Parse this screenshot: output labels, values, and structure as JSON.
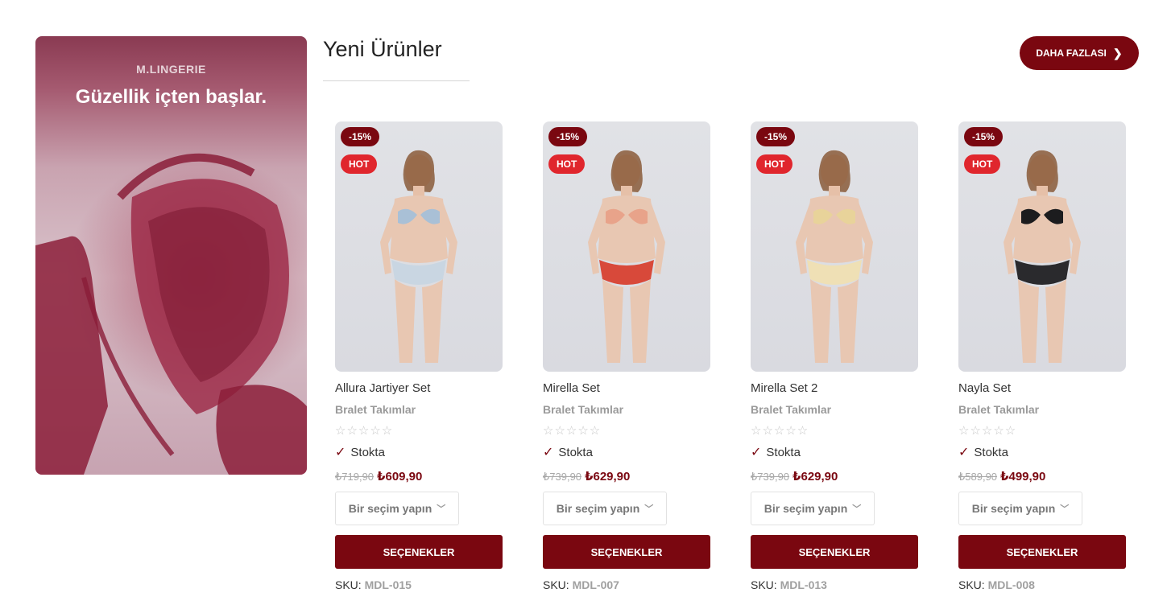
{
  "promo": {
    "brand": "M.LINGERIE",
    "tagline": "Güzellik içten başlar."
  },
  "header": {
    "title": "Yeni Ürünler",
    "more_label": "DAHA FAZLASI",
    "more_icon": "chevron-right-icon"
  },
  "colors": {
    "accent": "#7a0710",
    "hot": "#e0262d"
  },
  "products": [
    {
      "discount": "-15%",
      "hot": "HOT",
      "name": "Allura Jartiyer Set",
      "category": "Bralet Takımlar",
      "rating": 0,
      "stars": "☆☆☆☆☆",
      "stock": "Stokta",
      "old_price": "₺719,90",
      "new_price": "₺609,90",
      "select_label": "Bir seçim yapın",
      "button_label": "SEÇENEKLER",
      "sku_label": "SKU:",
      "sku": "MDL-015",
      "outfit": "light-blue-lace"
    },
    {
      "discount": "-15%",
      "hot": "HOT",
      "name": "Mirella Set",
      "category": "Bralet Takımlar",
      "rating": 0,
      "stars": "☆☆☆☆☆",
      "stock": "Stokta",
      "old_price": "₺739,90",
      "new_price": "₺629,90",
      "select_label": "Bir seçim yapın",
      "button_label": "SEÇENEKLER",
      "sku_label": "SKU:",
      "sku": "MDL-007",
      "outfit": "red-floral"
    },
    {
      "discount": "-15%",
      "hot": "HOT",
      "name": "Mirella Set 2",
      "category": "Bralet Takımlar",
      "rating": 0,
      "stars": "☆☆☆☆☆",
      "stock": "Stokta",
      "old_price": "₺739,90",
      "new_price": "₺629,90",
      "select_label": "Bir seçim yapın",
      "button_label": "SEÇENEKLER",
      "sku_label": "SKU:",
      "sku": "MDL-013",
      "outfit": "yellow-floral"
    },
    {
      "discount": "-15%",
      "hot": "HOT",
      "name": "Nayla Set",
      "category": "Bralet Takımlar",
      "rating": 0,
      "stars": "☆☆☆☆☆",
      "stock": "Stokta",
      "old_price": "₺589,90",
      "new_price": "₺499,90",
      "select_label": "Bir seçim yapın",
      "button_label": "SEÇENEKLER",
      "sku_label": "SKU:",
      "sku": "MDL-008",
      "outfit": "black-lace"
    }
  ]
}
